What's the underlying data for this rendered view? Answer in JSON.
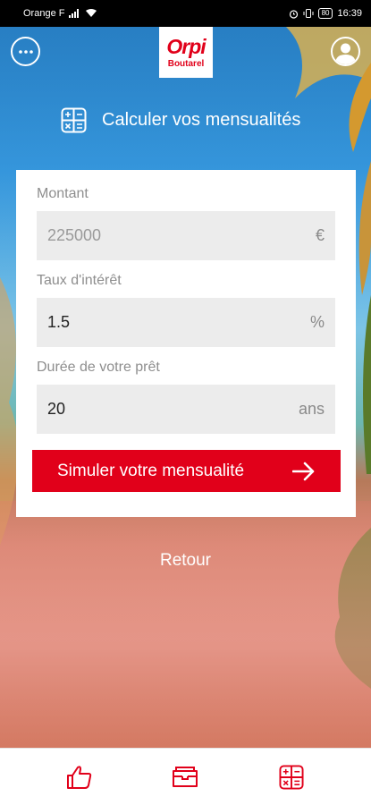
{
  "status_bar": {
    "carrier": "Orange F",
    "battery": "80",
    "time": "16:39"
  },
  "brand": {
    "name": "Orpi",
    "agency": "Boutarel",
    "color": "#e1001a"
  },
  "header": {
    "menu_icon": "more-horizontal-icon",
    "profile_icon": "user-profile-icon"
  },
  "page": {
    "title": "Calculer vos mensualités",
    "title_icon": "calculator-icon"
  },
  "form": {
    "amount": {
      "label": "Montant",
      "placeholder": "225000",
      "value": "",
      "unit": "€"
    },
    "rate": {
      "label": "Taux d'intérêt",
      "value": "1.5",
      "unit": "%"
    },
    "duration": {
      "label": "Durée de votre prêt",
      "value": "20",
      "unit": "ans"
    },
    "submit_label": "Simuler votre mensualité",
    "submit_icon": "arrow-right-icon"
  },
  "back_label": "Retour",
  "bottom_nav": {
    "items": [
      {
        "icon": "thumbs-up-icon"
      },
      {
        "icon": "folder-icon"
      },
      {
        "icon": "calculator-icon"
      }
    ]
  }
}
